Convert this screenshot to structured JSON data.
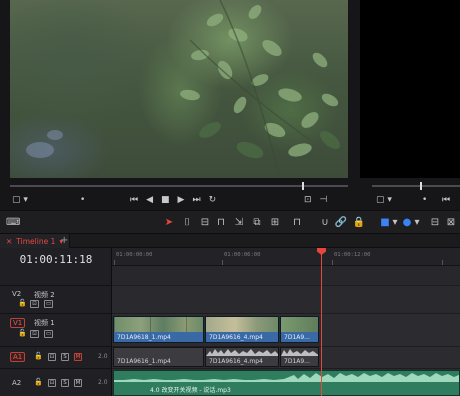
{
  "viewer": {
    "source_dots": "•",
    "transport": [
      "⏮",
      "◀",
      "■",
      "▶",
      "⏭",
      "↻"
    ]
  },
  "toolbar": {
    "icons": [
      "keyboard-icon",
      "pointer-icon",
      "trim-icon",
      "blade-icon",
      "snap-icon",
      "link-icon",
      "lock-icon",
      "flag-icon",
      "marker-icon"
    ]
  },
  "timeline": {
    "tab_label": "Timeline 1",
    "timecode": "01:00:11:18",
    "ruler_labels": [
      "01:00:00:00",
      "01:00:06:00",
      "01:00:12:00"
    ]
  },
  "tracks": {
    "v2": {
      "id": "V2",
      "name": "视频 2"
    },
    "v1": {
      "id": "V1",
      "name": "视频 1"
    },
    "a1": {
      "id": "A1",
      "channels": "2.0"
    },
    "a2": {
      "id": "A2",
      "channels": "2.0"
    }
  },
  "clips": {
    "video": [
      {
        "name": "7D1A9618_1.mp4"
      },
      {
        "name": "7D1A9616_4.mp4"
      },
      {
        "name": "7D1A9..."
      }
    ],
    "audio": [
      {
        "name": "7D1A9616_1.mp4"
      },
      {
        "name": "7D1A9616_4.mp4"
      },
      {
        "name": "7D1A9..."
      }
    ],
    "music": {
      "name": "4.0 改变开关视频 - 说话.mp3"
    }
  },
  "colors": {
    "accent": "#e8463c",
    "video_clip": "#3a6aa6",
    "music_clip": "#2f7d5e"
  }
}
